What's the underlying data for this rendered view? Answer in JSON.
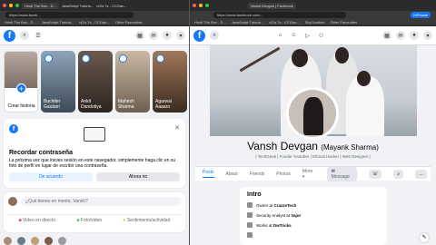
{
  "left": {
    "tabs": [
      "Hindi The Box - D...",
      "JavaScript Tutoria...",
      "nCls 7s - CCGan..."
    ],
    "url": "https://www.faceb...",
    "bookmarks": [
      "Hindi The Box - D...",
      "JavaScript Tutoria...",
      "nCls 7s - CCGan...",
      "Other Favourites"
    ],
    "stories": [
      {
        "name": "Crear historia"
      },
      {
        "name": "Buchtler Gautam"
      },
      {
        "name": "Ankit Dandotiya"
      },
      {
        "name": "Mahesh Sharma"
      },
      {
        "name": "Agarwal Aaaaro"
      }
    ],
    "remember": {
      "title": "Recordar contraseña",
      "body": "La próxima vez que inicies sesión en este navegador, simplemente haga clic en su foto de perfil en lugar de escribir una contraseña.",
      "accept": "De acuerdo",
      "later": "Ahora no"
    },
    "composer": {
      "placeholder": "¿Qué tienes en mente, Vansh?",
      "live": "Video en directo",
      "photo": "Foto/video",
      "feeling": "Sentimiento/actividad"
    }
  },
  "right": {
    "tabs": [
      "Vansh Devgan | Facebook"
    ],
    "url": "https://www.facebook.com/...",
    "bookmarks": [
      "Hindi The Box - D...",
      "JavaScript Tutoria...",
      "nCls 7s - CCGan...",
      "SkyGoodies",
      "Other Favourites"
    ],
    "inprivate": "InPrivate",
    "profile": {
      "name": "Vansh Devgan",
      "alt_name": "(Mayank Sharma)",
      "tagline": "| TechGeek | Foodie Youtuber | Ethical Hacker | Web Designer |",
      "tabs": [
        "Posts",
        "About",
        "Friends",
        "Photos",
        "More"
      ],
      "message": "Message"
    },
    "intro": {
      "title": "Intro",
      "rows": [
        {
          "prefix": "Owner at ",
          "bold": "CrazzeTech"
        },
        {
          "prefix": "Security Analyst at ",
          "bold": "Vajor"
        },
        {
          "prefix": "Works at ",
          "bold": "DwTricks"
        },
        {
          "prefix": "",
          "bold": ""
        }
      ]
    }
  },
  "colors": {
    "brand": "#1877f2",
    "bg": "#f0f2f5"
  }
}
